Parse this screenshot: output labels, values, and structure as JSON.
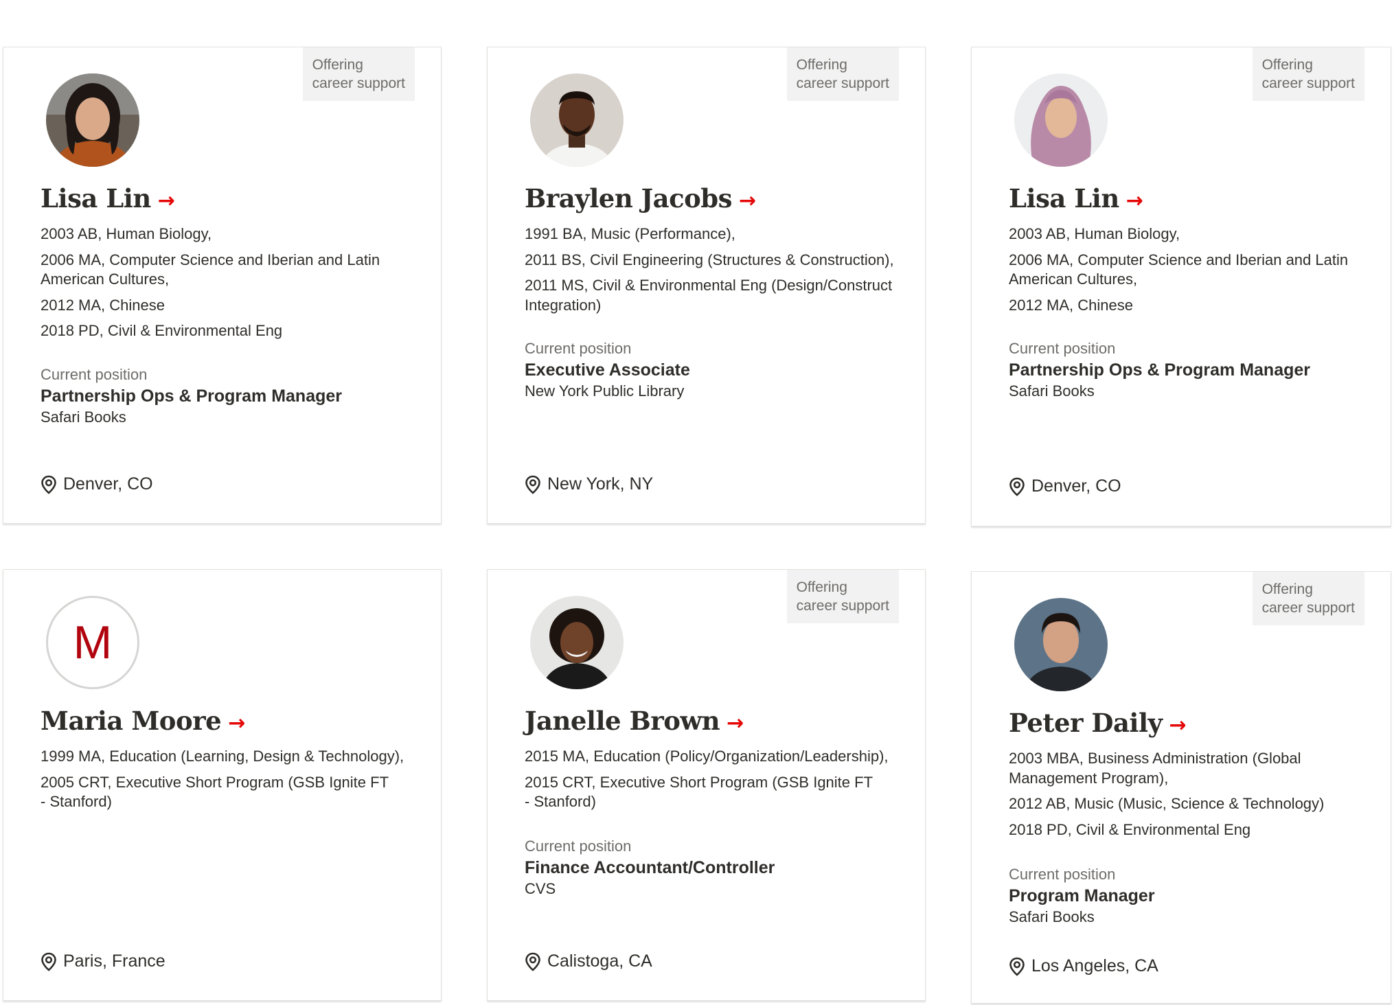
{
  "offering_badge": {
    "line1": "Offering",
    "line2": "career support"
  },
  "current_position_label": "Current position",
  "accent_color": "#e50808",
  "cards": [
    {
      "name": "Lisa Lin",
      "avatar": "photo",
      "degrees": [
        "2003 AB, Human Biology,",
        "2006 MA, Computer Science and Iberian and Latin American Cultures,",
        "2012 MA, Chinese",
        "2018 PD, Civil & Environmental Eng"
      ],
      "position_title": "Partnership Ops & Program Manager",
      "position_org": "Safari Books",
      "location": "Denver, CO"
    },
    {
      "name": "Braylen Jacobs",
      "avatar": "photo",
      "degrees": [
        "1991 BA, Music (Performance),",
        "2011 BS, Civil Engineering (Structures & Construction),",
        "2011 MS, Civil & Environmental Eng (Design/Construct Integration)"
      ],
      "position_title": "Executive Associate",
      "position_org": "New York Public Library",
      "location": "New York, NY"
    },
    {
      "name": "Lisa Lin",
      "avatar": "photo",
      "degrees": [
        "2003 AB, Human Biology,",
        "2006 MA, Computer Science and Iberian and Latin American Cultures,",
        "2012 MA, Chinese"
      ],
      "position_title": "Partnership Ops & Program Manager",
      "position_org": "Safari Books",
      "location": "Denver, CO"
    },
    {
      "name": "Maria Moore",
      "avatar_initial": "M",
      "degrees": [
        "1999 MA, Education (Learning, Design & Technology),",
        "2005 CRT, Executive Short Program (GSB Ignite FT - Stanford)"
      ],
      "location": "Paris, France"
    },
    {
      "name": "Janelle Brown",
      "avatar": "photo",
      "degrees": [
        "2015 MA, Education (Policy/Organization/Leadership),",
        "2015 CRT, Executive Short Program (GSB Ignite FT - Stanford)"
      ],
      "position_title": "Finance Accountant/Controller",
      "position_org": "CVS",
      "location": "Calistoga, CA"
    },
    {
      "name": "Peter Daily",
      "avatar": "photo",
      "degrees": [
        "2003 MBA, Business Administration (Global Management Program),",
        "2012 AB, Music (Music, Science & Technology)",
        "2018 PD, Civil & Environmental Eng"
      ],
      "position_title": "Program Manager",
      "position_org": "Safari Books",
      "location": "Los Angeles, CA"
    }
  ]
}
